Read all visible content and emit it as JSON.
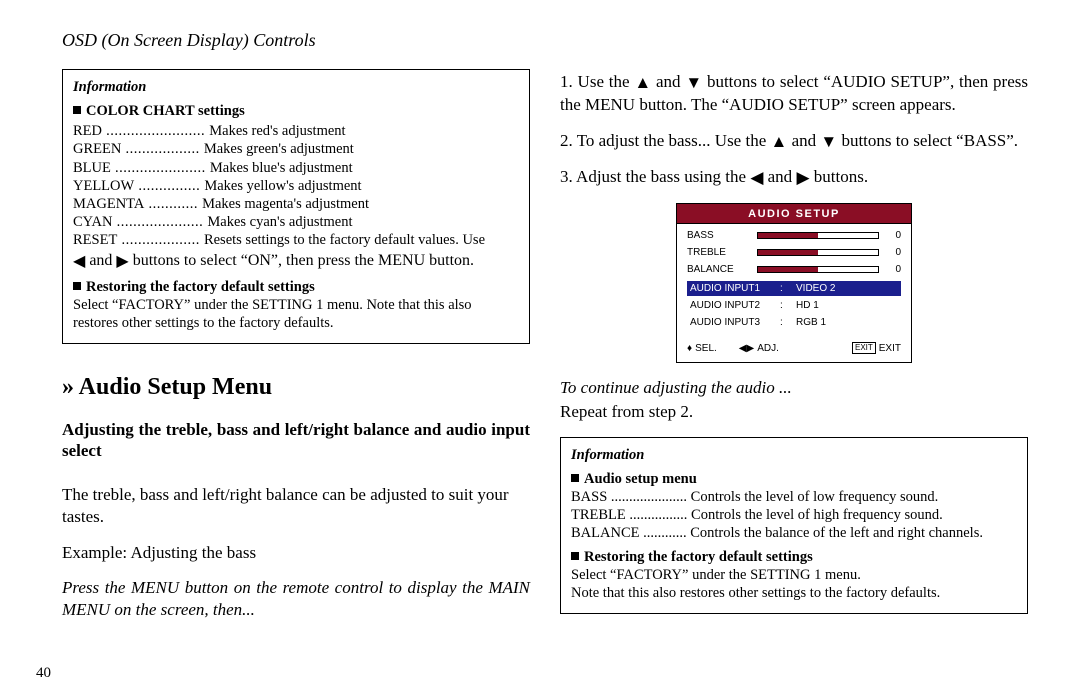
{
  "header": "OSD (On Screen Display) Controls",
  "page_number": "40",
  "left": {
    "info": {
      "title": "Information",
      "colorChartHeading": "COLOR CHART settings",
      "settings": [
        {
          "term": "RED",
          "dots": " ........................ ",
          "desc": "Makes red's adjustment"
        },
        {
          "term": "GREEN",
          "dots": " .................. ",
          "desc": "Makes green's adjustment"
        },
        {
          "term": "BLUE",
          "dots": " ...................... ",
          "desc": "Makes blue's adjustment"
        },
        {
          "term": "YELLOW",
          "dots": " ............... ",
          "desc": "Makes yellow's adjustment"
        },
        {
          "term": "MAGENTA",
          "dots": " ............ ",
          "desc": "Makes magenta's adjustment"
        },
        {
          "term": "CYAN",
          "dots": " ..................... ",
          "desc": "Makes cyan's adjustment"
        },
        {
          "term": "RESET",
          "dots": " ................... ",
          "desc": "Resets settings to the factory default values. Use "
        }
      ],
      "onOffLine_pre": "",
      "onOffLine_mid": " and ",
      "onOffLine_post": " buttons to select “ON”, then press the MENU button.",
      "restoreHeading": "Restoring the factory default settings",
      "restoreText": "Select “FACTORY” under the SETTING 1 menu. Note that this also restores other settings to the factory defaults."
    },
    "sectionTitle": " Audio Setup Menu",
    "lead": "Adjusting the treble, bass and left/right balance and audio input select",
    "para1": "The treble, bass and left/right balance can be adjusted to suit your tastes.",
    "example": "Example: Adjusting the bass",
    "press": "Press the MENU button on the remote control to display the MAIN MENU on the screen, then..."
  },
  "right": {
    "step1_pre": "1. Use the ",
    "step1_mid": " and ",
    "step1_post": " buttons to select “AUDIO SETUP”, then press the MENU button. The “AUDIO SETUP” screen appears.",
    "step2_pre": "2. To adjust the bass... Use the ",
    "step2_mid": " and ",
    "step2_post": " buttons to select “BASS”.",
    "step3_pre": "3. Adjust the bass using the ",
    "step3_mid": " and ",
    "step3_post": " buttons.",
    "menu": {
      "title": "AUDIO SETUP",
      "rows": [
        {
          "label": "BASS",
          "value": "0"
        },
        {
          "label": "TREBLE",
          "value": "0"
        },
        {
          "label": "BALANCE",
          "value": "0"
        }
      ],
      "inputs": [
        {
          "label": "AUDIO INPUT1",
          "value": "VIDEO 2",
          "selected": true
        },
        {
          "label": "AUDIO INPUT2",
          "value": "HD 1",
          "selected": false
        },
        {
          "label": "AUDIO INPUT3",
          "value": "RGB 1",
          "selected": false
        }
      ],
      "footer": {
        "sel": "SEL.",
        "adj": "ADJ.",
        "exitbox": "EXIT",
        "exit": "EXIT"
      }
    },
    "continueLine": "To continue adjusting the audio ...",
    "repeat": "Repeat from step 2.",
    "info": {
      "title": "Information",
      "audioHeading": "Audio setup menu",
      "items": [
        {
          "term": "BASS",
          "dots": " ..................... ",
          "desc": "Controls the level of low frequency sound."
        },
        {
          "term": "TREBLE",
          "dots": " ................ ",
          "desc": "Controls the level of high frequency sound."
        },
        {
          "term": "BALANCE",
          "dots": " ............ ",
          "desc": "Controls the balance of the left and right channels."
        }
      ],
      "restoreHeading": "Restoring the factory default settings",
      "restoreText1": "Select “FACTORY” under the SETTING 1 menu.",
      "restoreText2": "Note that this also restores other settings to the factory defaults."
    }
  }
}
